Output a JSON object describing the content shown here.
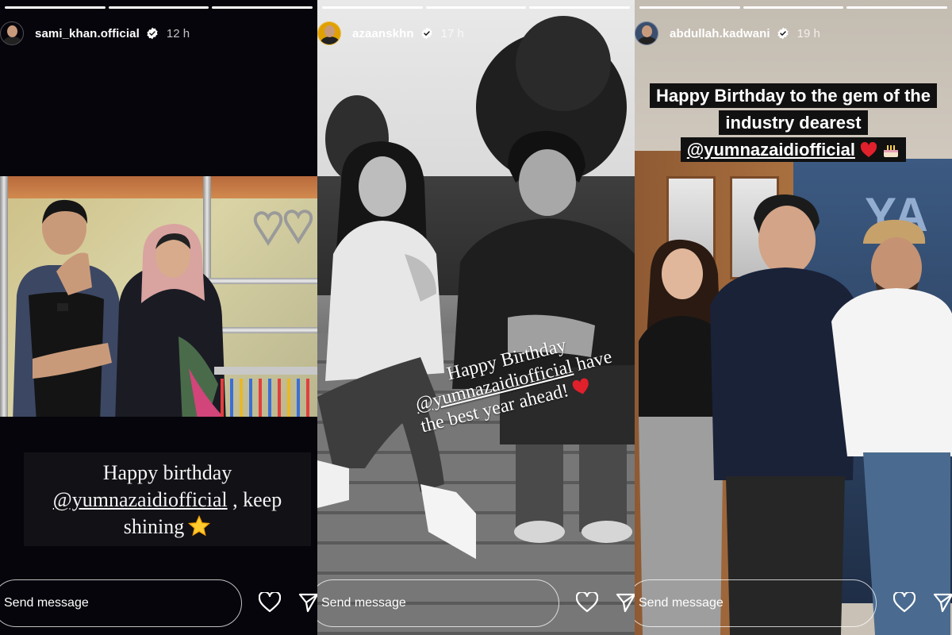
{
  "stories": [
    {
      "username": "sami_khan.official",
      "time": "12 h",
      "progress": [
        1,
        1,
        1
      ],
      "caption": {
        "line1": "Happy birthday",
        "mention": "@yumnazaidiofficial",
        "after_mention": " , keep",
        "line3": "shining"
      },
      "send_placeholder": "Send message"
    },
    {
      "username": "azaanskhn",
      "time": "17 h",
      "progress": [
        1,
        1,
        1
      ],
      "caption": {
        "line1": "Happy Birthday",
        "mention": "@yumnazaidiofficial",
        "after_mention": " have",
        "line3": "the best year ahead!"
      },
      "send_placeholder": "Send message"
    },
    {
      "username": "abdullah.kadwani",
      "time": "19 h",
      "progress": [
        1,
        1,
        1
      ],
      "caption": {
        "line1": "Happy Birthday to the gem of the",
        "line2": "industry dearest",
        "mention": "@yumnazaidiofficial"
      },
      "poster_text": "YA",
      "send_placeholder": "Send message"
    }
  ],
  "colors": {
    "accent_heart": "#e0202b",
    "verified_badge": "#ffffff"
  },
  "icons": [
    "verified-icon",
    "more-icon",
    "heart-icon",
    "send-icon",
    "star-emoji",
    "red-heart-emoji",
    "cake-emoji"
  ]
}
